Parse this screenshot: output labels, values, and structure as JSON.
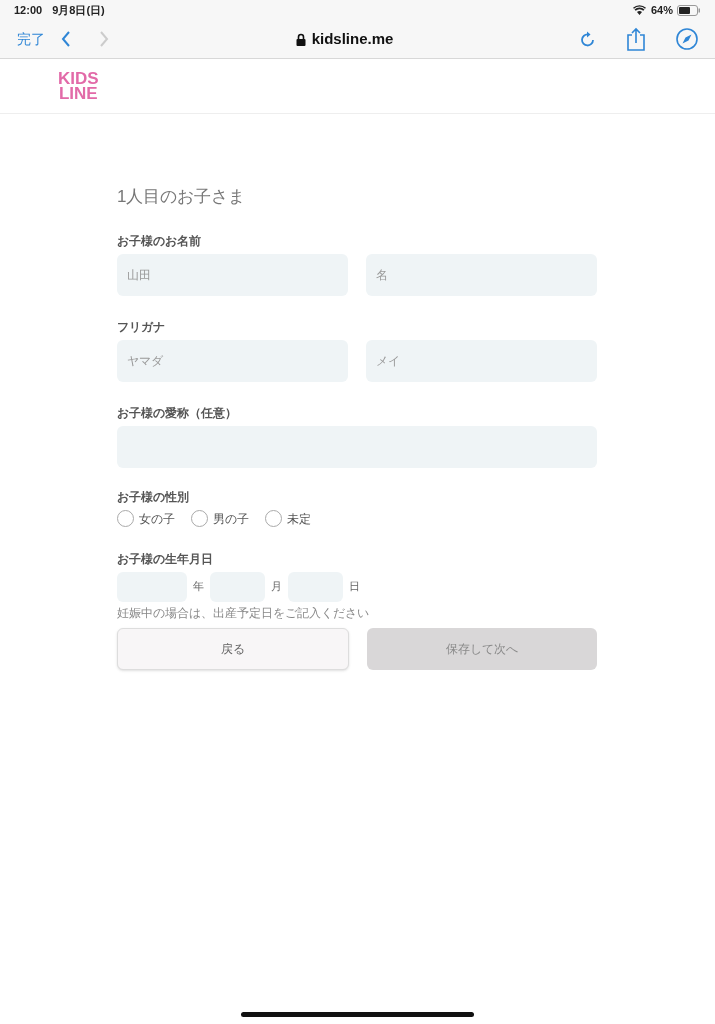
{
  "status_bar": {
    "time": "12:00",
    "date": "9月8日(日)",
    "battery": "64%"
  },
  "browser": {
    "done": "完了",
    "url": "kidsline.me"
  },
  "logo": {
    "line_1": "KIDS",
    "line_2": "LINE"
  },
  "form": {
    "title": "1人目のお子さま",
    "name": {
      "label": "お子様のお名前",
      "fields": [
        {
          "placeholder": "山田"
        },
        {
          "placeholder": "名"
        }
      ]
    },
    "kana": {
      "label": "フリガナ",
      "fields": [
        {
          "placeholder": "ヤマダ"
        },
        {
          "placeholder": "メイ"
        }
      ]
    },
    "nickname": {
      "label": "お子様の愛称（任意）"
    },
    "gender": {
      "label": "お子様の性別",
      "options": [
        {
          "label": "女の子",
          "selected": false
        },
        {
          "label": "男の子",
          "selected": false
        },
        {
          "label": "未定",
          "selected": false
        }
      ]
    },
    "birthday": {
      "label": "お子様の生年月日",
      "units": [
        "年",
        "月",
        "日"
      ],
      "note": "妊娠中の場合は、出産予定日をご記入ください"
    },
    "buttons": [
      {
        "label": "戻る",
        "disabled": false
      },
      {
        "label": "保存して次へ",
        "disabled": true
      }
    ]
  }
}
